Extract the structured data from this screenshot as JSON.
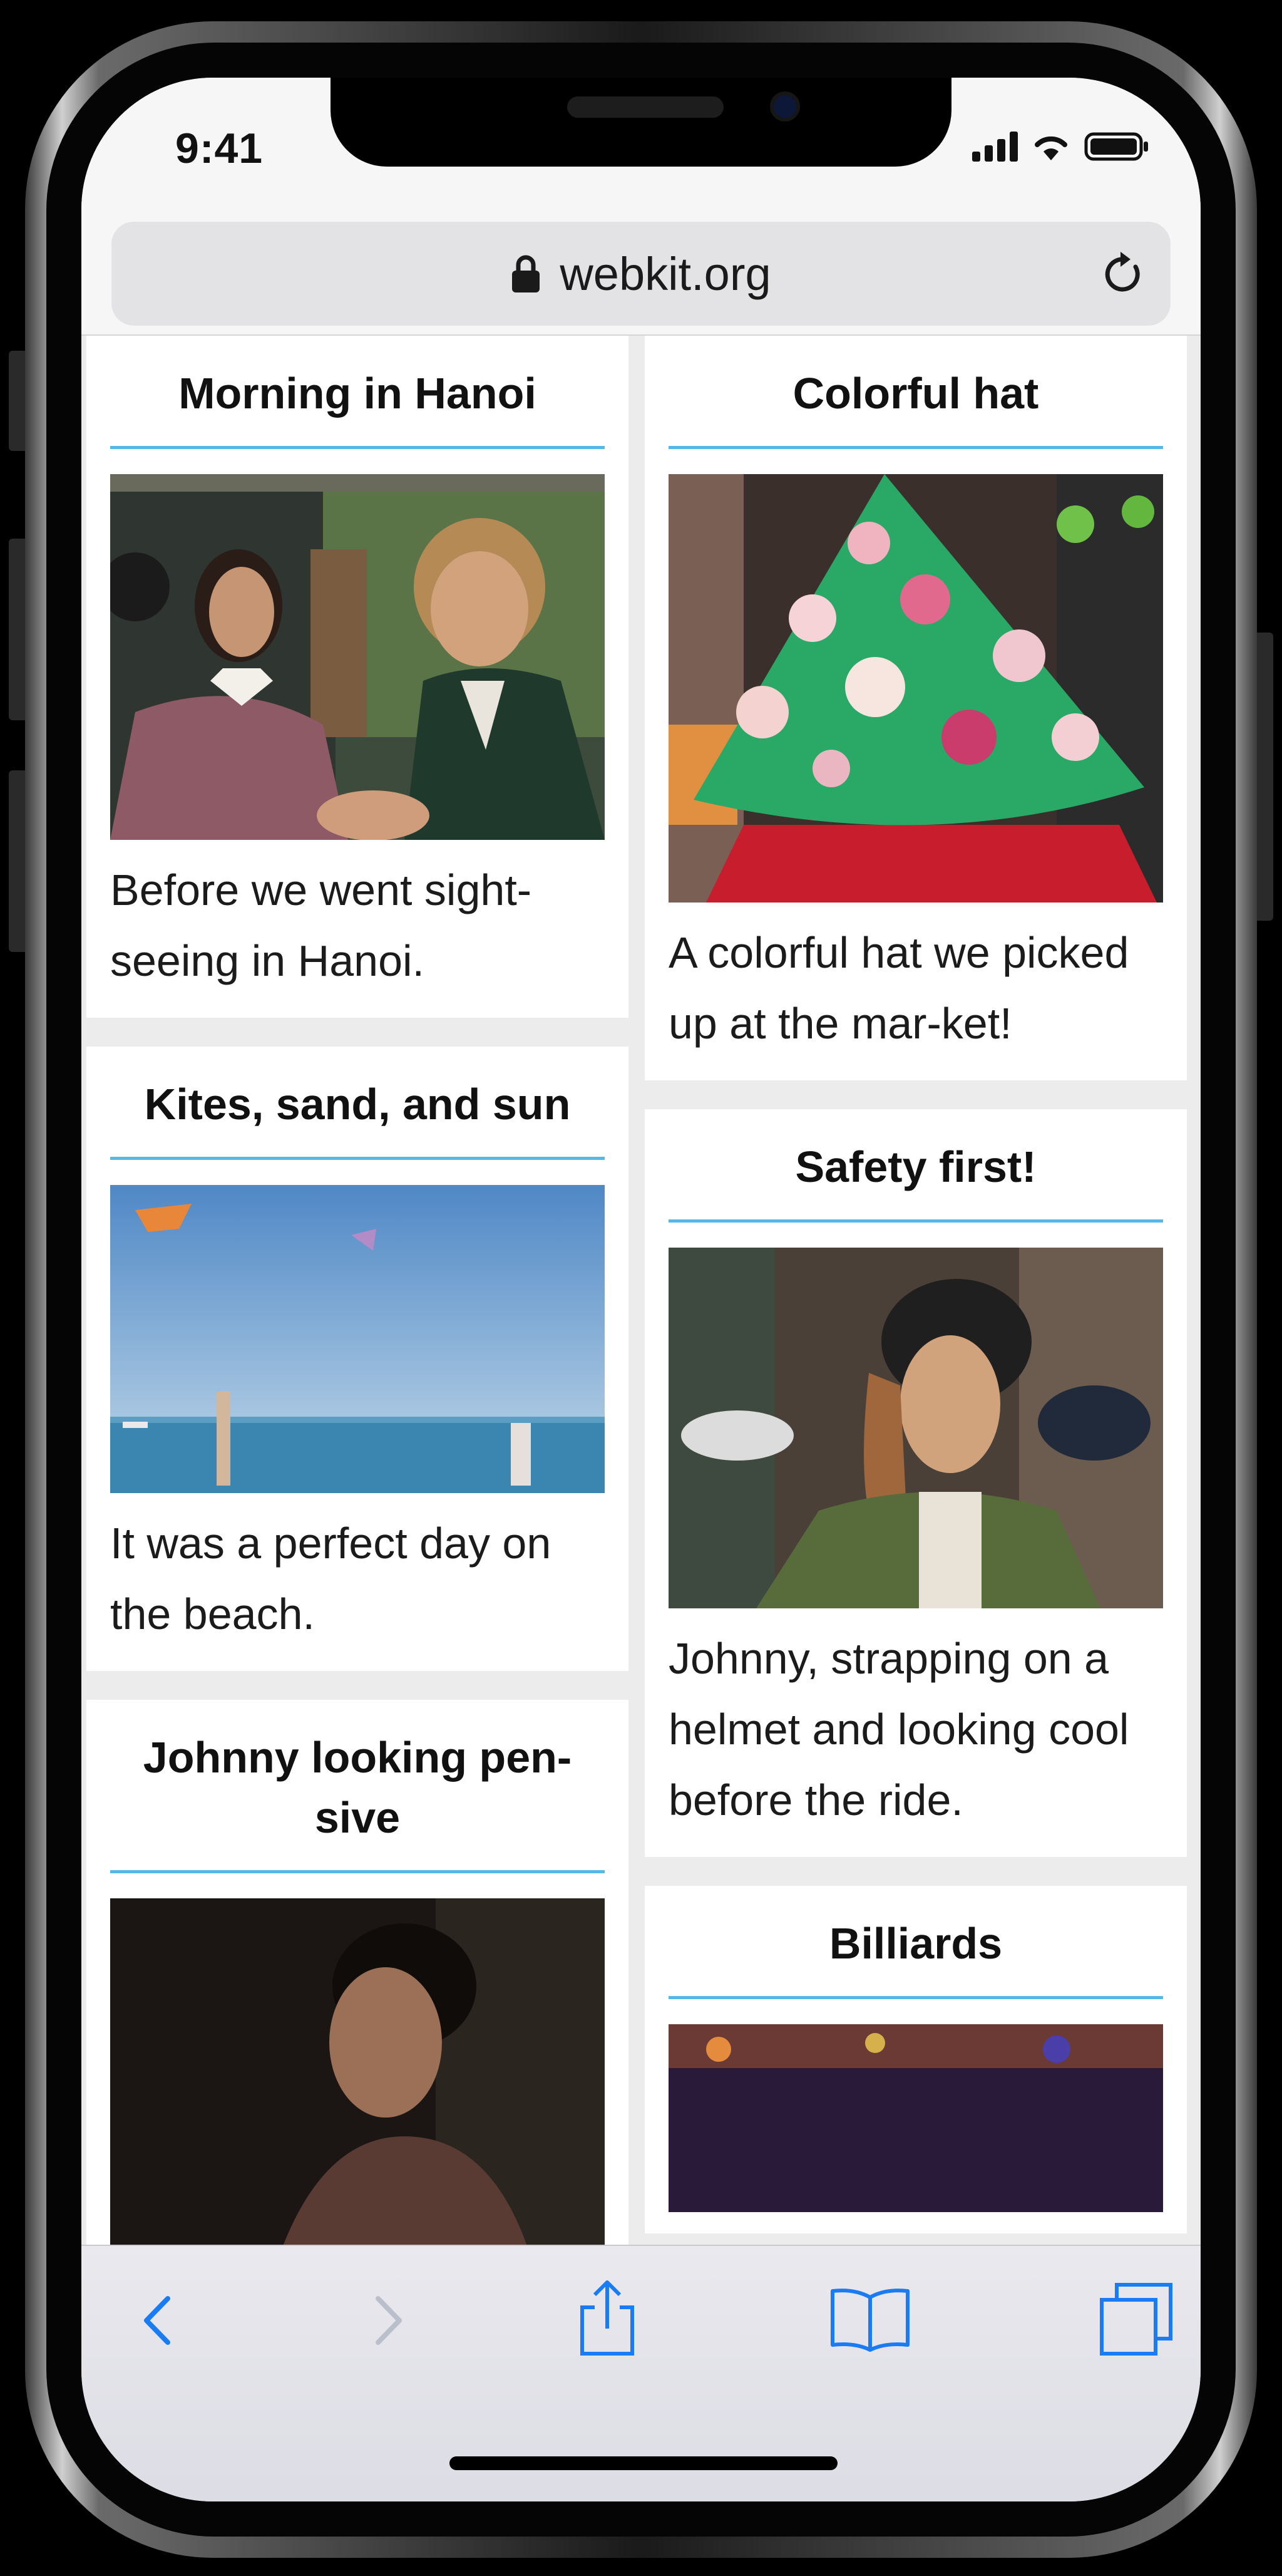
{
  "status_bar": {
    "time": "9:41"
  },
  "address_bar": {
    "url": "webkit.org"
  },
  "columns": {
    "left": [
      {
        "title": "Morning in Hanoi",
        "caption": "Before we went sight-seeing in Hanoi."
      },
      {
        "title": "Kites, sand, and sun",
        "caption": "It was a perfect day on the beach."
      },
      {
        "title": "Johnny looking pen-sive",
        "caption": ""
      }
    ],
    "right": [
      {
        "title": "Colorful hat",
        "caption": "A colorful hat we picked up at the mar-ket!"
      },
      {
        "title": "Safety first!",
        "caption": "Johnny, strapping on a helmet and looking cool before the ride."
      },
      {
        "title": "Billiards",
        "caption": ""
      }
    ]
  },
  "toolbar": {
    "icons": [
      "back-icon",
      "forward-icon",
      "share-icon",
      "bookmarks-icon",
      "tabs-icon"
    ],
    "accent": "#1a7cf5",
    "disabled": "#b9c0cc"
  },
  "theme": {
    "divider": "#56b8e6",
    "card_bg": "#ffffff",
    "page_bg": "#ececec"
  }
}
